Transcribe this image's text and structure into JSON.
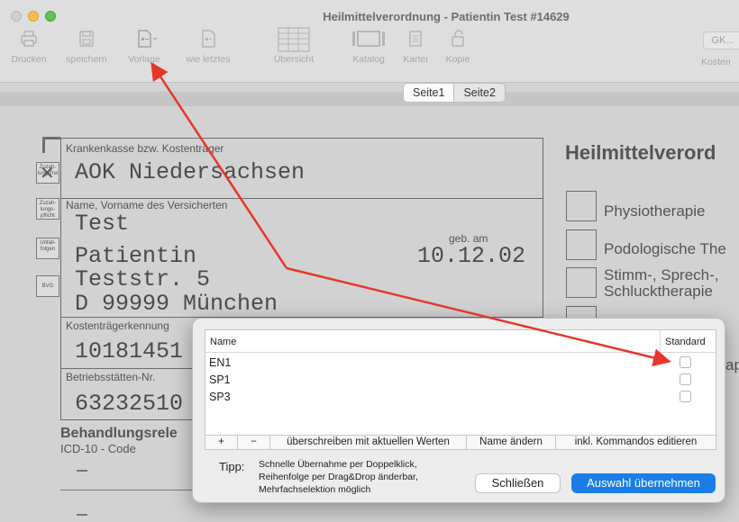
{
  "window": {
    "title": "Heilmittelverordnung -  Patientin Test #14629"
  },
  "toolbar": [
    {
      "label": "Drucken",
      "icon": "printer-icon"
    },
    {
      "label": "speichern",
      "icon": "save-icon"
    },
    {
      "label": "Vorlage",
      "icon": "template-icon"
    },
    {
      "label": "wie letztes",
      "icon": "copy-last-icon"
    },
    {
      "label": "Übersicht",
      "icon": "table-icon"
    },
    {
      "label": "Katalog",
      "icon": "catalog-icon"
    },
    {
      "label": "Kartei",
      "icon": "card-icon"
    },
    {
      "label": "Kopie",
      "icon": "lock-icon"
    },
    {
      "label": "Kosten",
      "icon": "gk-badge-icon",
      "badge": "GK..."
    }
  ],
  "tabs": [
    "Seite1",
    "Seite2"
  ],
  "form": {
    "insurer_label": "Krankenkasse bzw. Kostenträger",
    "insurer_value": "AOK Niedersachsen",
    "name_label": "Name, Vorname des Versicherten",
    "lastname": "Test",
    "firstname": "Patientin",
    "dob_label": "geb. am",
    "dob": "10.12.02",
    "street": "Teststr. 5",
    "city": "D 99999 München",
    "cost_label": "Kostenträgerkennung",
    "cost_value": "10181451",
    "bsnr_label": "Betriebsstätten-Nr.",
    "bsnr_value": "63232510",
    "treat_label": "Behandlungsrele",
    "icd_label": "ICD-10 - Code",
    "side_boxes": [
      "Zuzah-lungsfrei",
      "Zuzah-lungs-pflicht",
      "Unfall-folgen",
      "BVG"
    ],
    "heading": "Heilmittelverord",
    "options": [
      "Physiotherapie",
      "Podologische The",
      "Stimm-, Sprech-,",
      "Schlucktherapie"
    ],
    "option_tail": "ap"
  },
  "dialog": {
    "col_name": "Name",
    "col_standard": "Standard",
    "rows": [
      {
        "name": "EN1",
        "standard": false
      },
      {
        "name": "SP1",
        "standard": false
      },
      {
        "name": "SP3",
        "standard": false
      }
    ],
    "bar": [
      "+",
      "−",
      "überschreiben mit aktuellen Werten",
      "Name ändern",
      "inkl. Kommandos editieren"
    ],
    "tip_label": "Tipp:",
    "tip_text": "Schnelle Übernahme per Doppelklick, Reihenfolge per Drag&Drop änderbar, Mehrfachselektion möglich",
    "close_label": "Schließen",
    "ok_label": "Auswahl übernehmen"
  },
  "colors": {
    "accent": "#1b7ee8",
    "arrow": "#e8352b"
  }
}
